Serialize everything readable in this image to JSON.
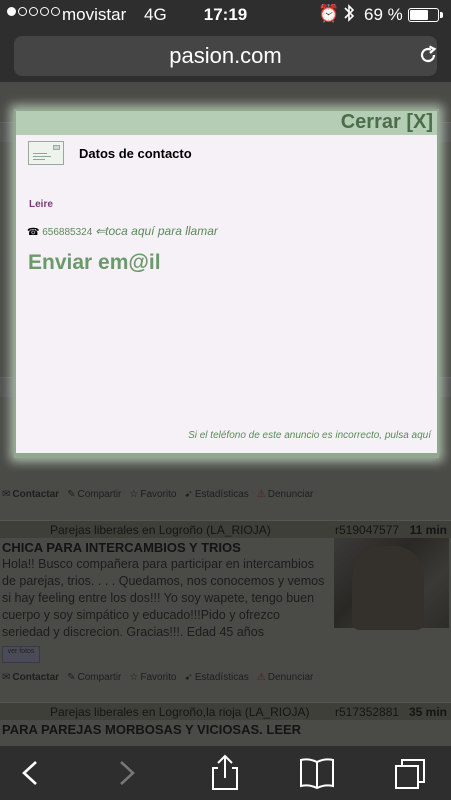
{
  "status_bar": {
    "carrier": "movistar",
    "network": "4G",
    "time": "17:19",
    "battery_text": "69 %",
    "battery_level": 0.69,
    "signal_dots_filled": 1,
    "signal_dots_total": 5
  },
  "browser": {
    "url": "pasion.com"
  },
  "modal": {
    "close_label": "Cerrar [X]",
    "title": "Datos de contacto",
    "contact_name": "Leire",
    "phone": "656885324",
    "phone_hint": "⇐toca aquí para llamar",
    "email_label": "Enviar em@il",
    "report_text": "Si el teléfono de este anuncio es incorrecto, pulsa aquí"
  },
  "action_bar": {
    "contact": "Contactar",
    "share": "Compartir",
    "favorite": "Favorito",
    "stats": "Estadísticas",
    "report": "Denunciar"
  },
  "listings": [
    {
      "category": "Parejas liberales en Logroño (LA_RIOJA)",
      "ref": "r519047577",
      "age": "11 min",
      "title": "CHICA PARA INTERCAMBIOS Y TRIOS",
      "text": "Hola!! Busco compañera para participar en intercambios de parejas, trios. . . . Quedamos, nos conocemos y vemos si hay feeling entre los dos!!! Yo soy wapete, tengo buen cuerpo y soy simpático y educado!!!Pido y ofrezco seriedad y discrecion. Gracias!!!. Edad 45 años",
      "photos_button": "ver fotos"
    },
    {
      "category": "Parejas liberales en Logroño,la rioja (LA_RIOJA)",
      "ref": "r517352881",
      "age": "35 min",
      "title": "PARA PAREJAS MORBOSAS Y VICIOSAS. LEER"
    }
  ]
}
